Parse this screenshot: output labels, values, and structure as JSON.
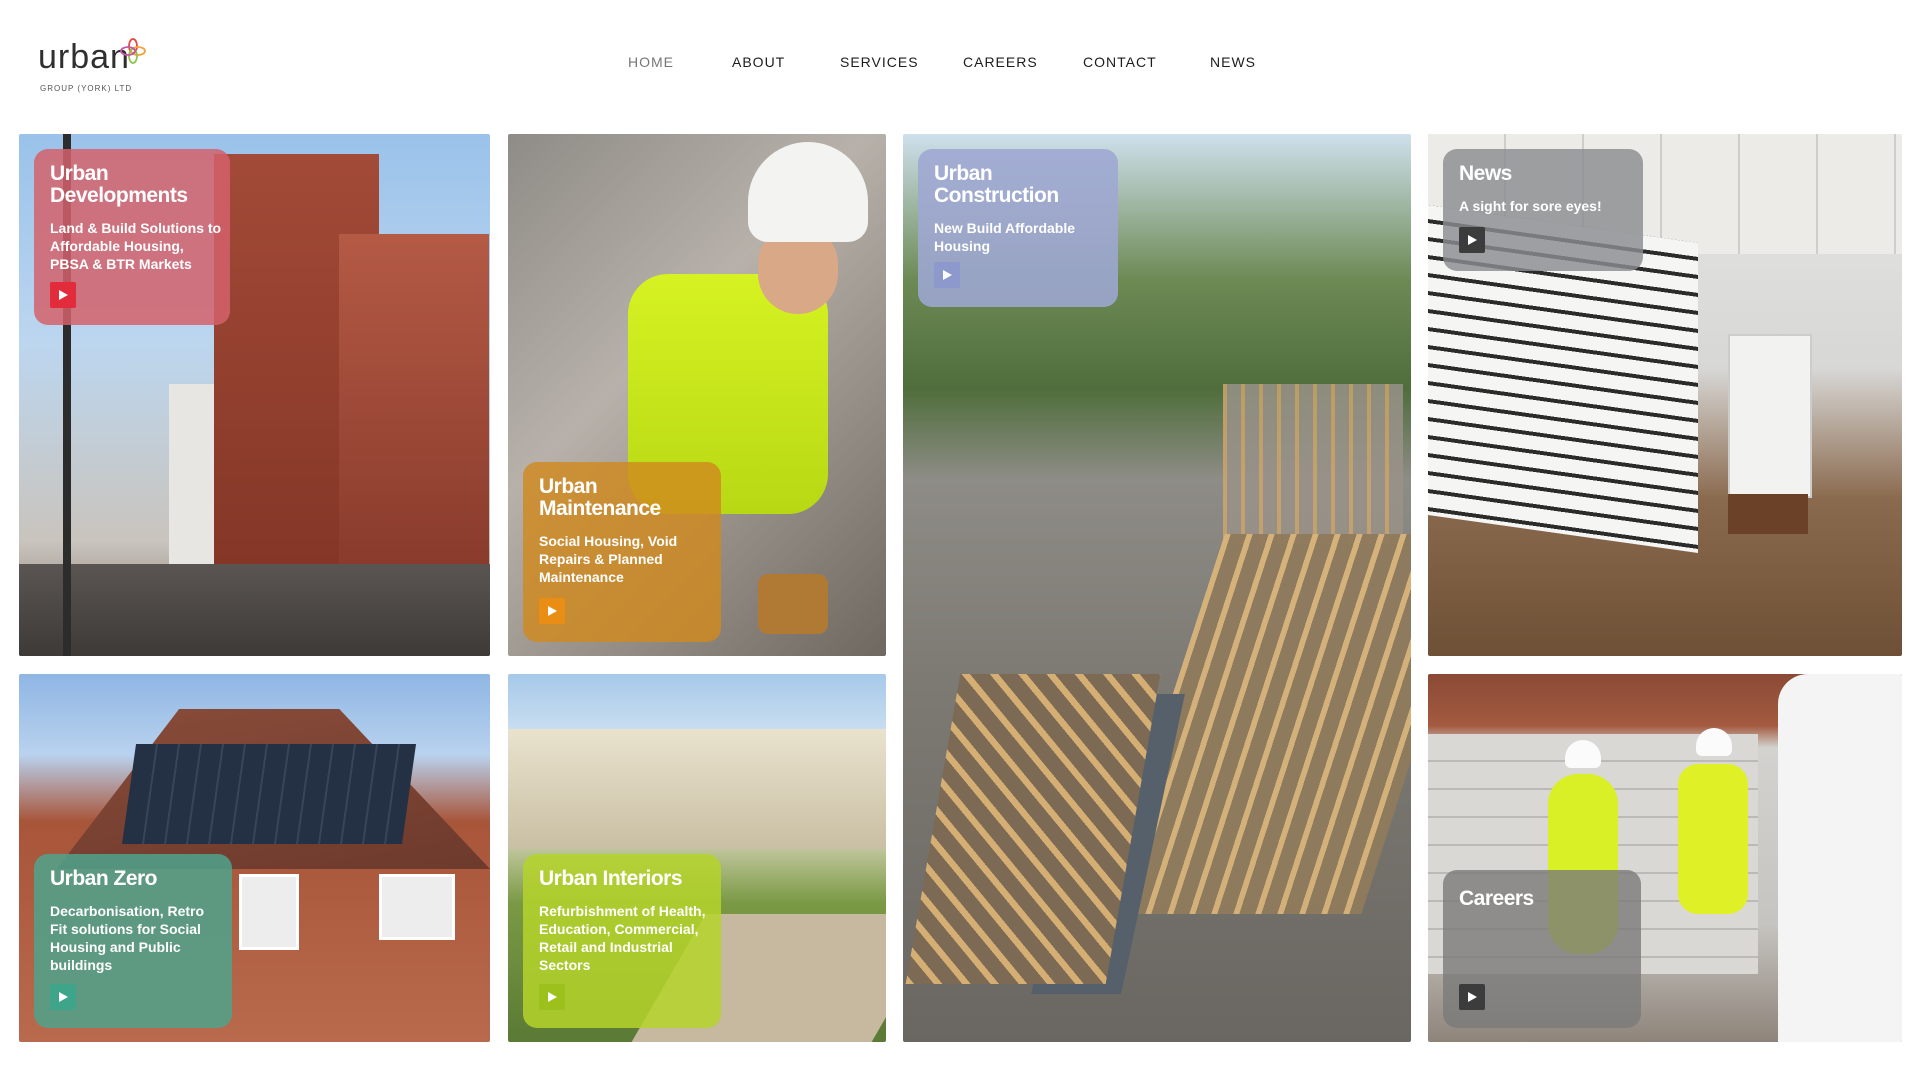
{
  "brand": {
    "name": "urban",
    "tagline": "GROUP (YORK) LTD",
    "colors": [
      "#e8453c",
      "#f2a43a",
      "#8fc44b",
      "#6e8fd0",
      "#c35aa6"
    ]
  },
  "nav": {
    "items": [
      "HOME",
      "ABOUT",
      "SERVICES",
      "CAREERS",
      "CONTACT",
      "NEWS"
    ],
    "active": "HOME"
  },
  "tiles": {
    "developments": {
      "title": "Urban Developments",
      "subtitle": "Land & Build Solutions to Affordable Housing, PBSA & BTR Markets",
      "card_color": "#d4626b",
      "play_color": "#e22b3b",
      "icon": "play-icon"
    },
    "maintenance": {
      "title": "Urban Maintenance",
      "subtitle": "Social Housing, Void Repairs & Planned Maintenance",
      "card_color": "#d18a1e",
      "play_color": "#e98d15",
      "icon": "play-icon"
    },
    "construction": {
      "title": "Urban Construction",
      "subtitle": "New Build Affordable Housing",
      "card_color": "#9ea7d3",
      "play_color": "#8d98cc",
      "icon": "play-icon"
    },
    "news": {
      "title": "News",
      "subtitle": "A sight for sore eyes!",
      "card_color": "#8a8c90",
      "play_color": "#3c3c3c",
      "icon": "play-icon"
    },
    "zero": {
      "title": "Urban Zero",
      "subtitle": "Decarbonisation, Retro Fit solutions for Social Housing and Public buildings",
      "card_color": "#4fa38c",
      "play_color": "#3ea58a",
      "icon": "play-icon"
    },
    "interiors": {
      "title": "Urban Interiors",
      "subtitle": "Refurbishment of Health, Education, Commercial, Retail and Industrial Sectors",
      "card_color": "#b4d32a",
      "play_color": "#9cc11c",
      "icon": "play-icon"
    },
    "careers": {
      "title": "Careers",
      "card_color": "#7b7a79",
      "play_color": "#3c3c3c",
      "icon": "play-icon"
    }
  }
}
